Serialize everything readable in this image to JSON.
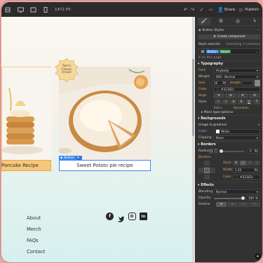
{
  "topbar": {
    "width": "1472 PX",
    "share": "Share",
    "publish": "Publish"
  },
  "canvas": {
    "badge": [
      "Tom's",
      "Classic",
      "recipe"
    ],
    "card1_title": "Pancake Recipe",
    "card2_title": "Sweet Potato pie recipe",
    "selected_tag": "Button",
    "footer_links": [
      "About",
      "Merch",
      "FAQs",
      "Contact"
    ],
    "social": [
      "facebook-icon",
      "twitter-icon",
      "instagram-icon",
      "linkedin-icon"
    ]
  },
  "panel": {
    "tabs": [
      "style-brush-icon",
      "gear-icon",
      "interactions-icon",
      "lightning-icon"
    ],
    "element": "Button Styles",
    "create_component": "Create component",
    "style_selector": "Style selector",
    "inheriting": "Inheriting 3 selectors",
    "selector_tags": [
      "Button",
      "Hover"
    ],
    "on_page": "4 on this page",
    "typography": {
      "heading": "Typography",
      "font_label": "Font",
      "font_value": "Anybody",
      "weight_label": "Weight",
      "weight_value": "600 - Normal",
      "size_label": "Size",
      "size_value": "16",
      "height_label": "Height",
      "color_label": "Color",
      "color_value": "#31302c",
      "align_label": "Align",
      "style_label": "Style",
      "italics": "Italics",
      "decoration": "Decoration",
      "more": "More type options"
    },
    "backgrounds": {
      "heading": "Backgrounds",
      "image_gradient": "Image & gradient",
      "color_label": "Color",
      "color_value": "White",
      "clipping_label": "Clipping",
      "clipping_value": "None"
    },
    "borders": {
      "heading": "Borders",
      "radius_label": "Radius",
      "radius_value": "0",
      "borders_label": "Borders",
      "style_label": "Style",
      "width_label": "Width",
      "width_value": "1.25",
      "color_label": "Color",
      "color_value": "#31302c"
    },
    "effects": {
      "heading": "Effects",
      "blending_label": "Blending",
      "blending_value": "Normal",
      "opacity_label": "Opacity",
      "opacity_value": "100",
      "outline_label": "Outline"
    }
  }
}
